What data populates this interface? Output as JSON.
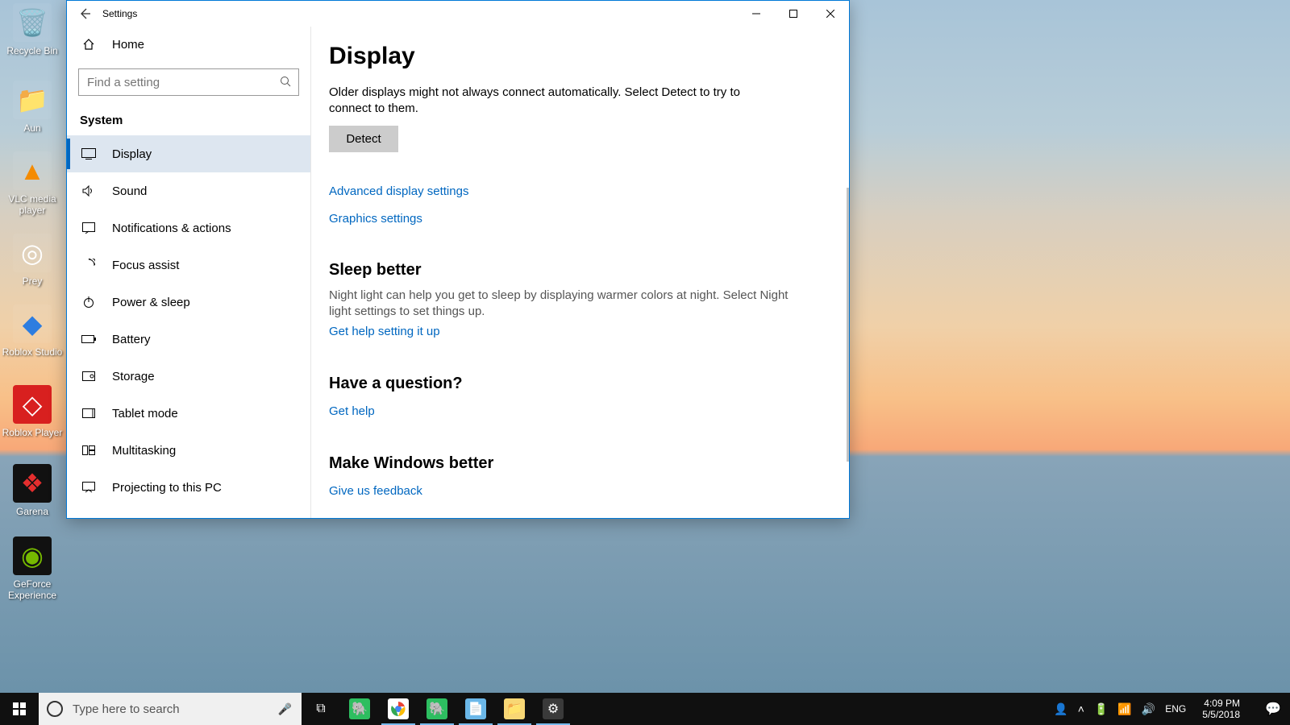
{
  "desktop_icons": [
    {
      "label": "Recycle Bin"
    },
    {
      "label": "Aun"
    },
    {
      "label": "VLC media player"
    },
    {
      "label": "Prey"
    },
    {
      "label": "Roblox Studio"
    },
    {
      "label": "Roblox Player"
    },
    {
      "label": "Garena"
    },
    {
      "label": "GeForce Experience"
    }
  ],
  "window": {
    "title": "Settings",
    "home_label": "Home",
    "search_placeholder": "Find a setting",
    "section": "System",
    "nav": [
      {
        "label": "Display",
        "selected": true
      },
      {
        "label": "Sound"
      },
      {
        "label": "Notifications & actions"
      },
      {
        "label": "Focus assist"
      },
      {
        "label": "Power & sleep"
      },
      {
        "label": "Battery"
      },
      {
        "label": "Storage"
      },
      {
        "label": "Tablet mode"
      },
      {
        "label": "Multitasking"
      },
      {
        "label": "Projecting to this PC"
      }
    ]
  },
  "content": {
    "heading": "Display",
    "detect_desc": "Older displays might not always connect automatically. Select Detect to try to connect to them.",
    "detect_btn": "Detect",
    "link_advanced": "Advanced display settings",
    "link_graphics": "Graphics settings",
    "sleep_h": "Sleep better",
    "sleep_desc": "Night light can help you get to sleep by displaying warmer colors at night. Select Night light settings to set things up.",
    "sleep_link": "Get help setting it up",
    "question_h": "Have a question?",
    "question_link": "Get help",
    "better_h": "Make Windows better",
    "better_link": "Give us feedback"
  },
  "taskbar": {
    "search_placeholder": "Type here to search",
    "lang": "ENG",
    "time": "4:09 PM",
    "date": "5/5/2018"
  }
}
